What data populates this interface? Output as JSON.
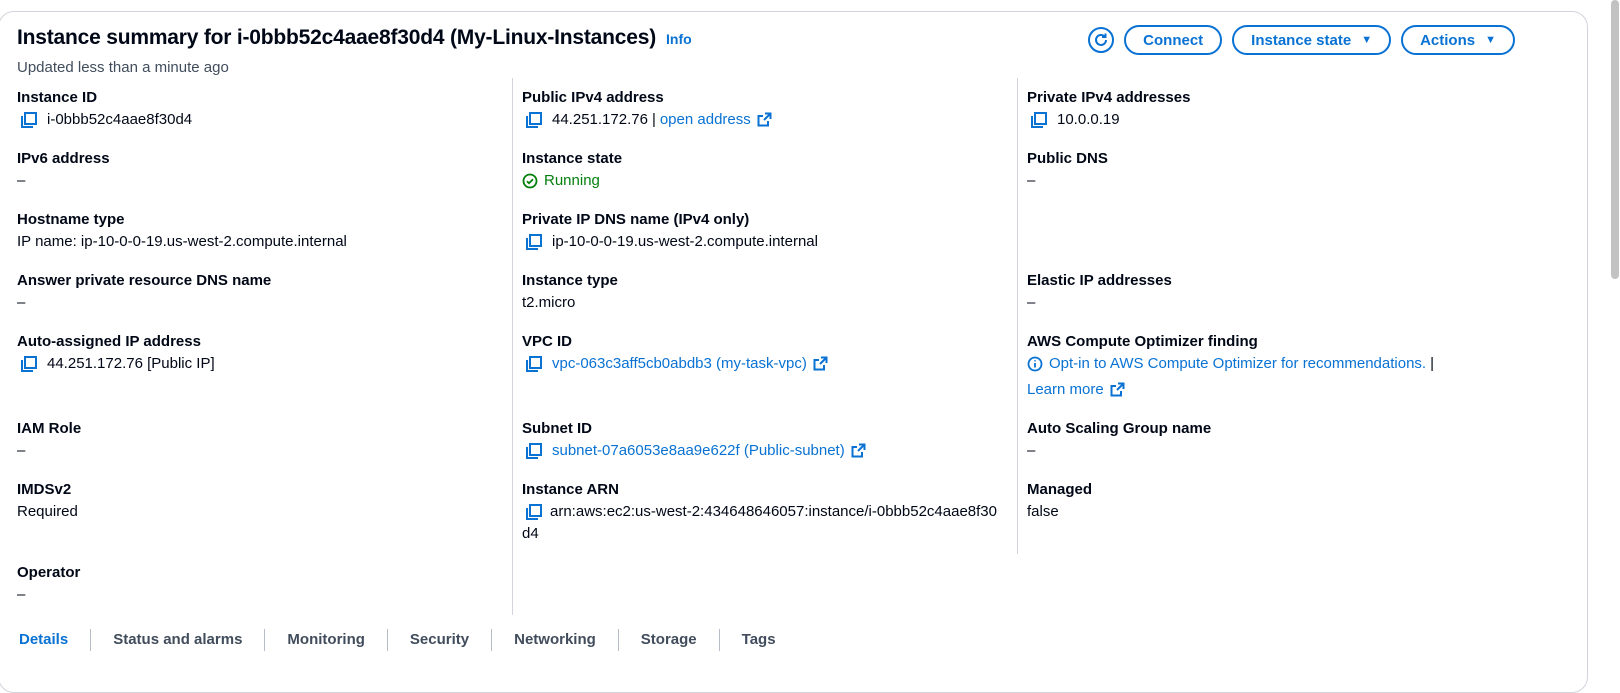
{
  "header": {
    "title": "Instance summary for i-0bbb52c4aae8f30d4 (My-Linux-Instances)",
    "info_link": "Info",
    "updated": "Updated less than a minute ago",
    "connect_label": "Connect",
    "instance_state_label": "Instance state",
    "actions_label": "Actions"
  },
  "fields": {
    "instance_id": {
      "label": "Instance ID",
      "value": "i-0bbb52c4aae8f30d4"
    },
    "public_ipv4": {
      "label": "Public IPv4 address",
      "value": "44.251.172.76",
      "separator": "|",
      "link": "open address"
    },
    "private_ipv4": {
      "label": "Private IPv4 addresses",
      "value": "10.0.0.19"
    },
    "ipv6": {
      "label": "IPv6 address",
      "value": "–"
    },
    "instance_state": {
      "label": "Instance state",
      "value": "Running"
    },
    "public_dns": {
      "label": "Public DNS",
      "value": "–"
    },
    "hostname_type": {
      "label": "Hostname type",
      "value": "IP name: ip-10-0-0-19.us-west-2.compute.internal"
    },
    "private_dns": {
      "label": "Private IP DNS name (IPv4 only)",
      "value": "ip-10-0-0-19.us-west-2.compute.internal"
    },
    "answer_dns": {
      "label": "Answer private resource DNS name",
      "value": "–"
    },
    "instance_type": {
      "label": "Instance type",
      "value": "t2.micro"
    },
    "elastic_ip": {
      "label": "Elastic IP addresses",
      "value": "–"
    },
    "auto_ip": {
      "label": "Auto-assigned IP address",
      "value": "44.251.172.76 [Public IP]"
    },
    "vpc_id": {
      "label": "VPC ID",
      "value": "vpc-063c3aff5cb0abdb3 (my-task-vpc)"
    },
    "optimizer": {
      "label": "AWS Compute Optimizer finding",
      "value": "Opt-in to AWS Compute Optimizer for recommendations.",
      "separator": "|",
      "learn_more": "Learn more"
    },
    "iam_role": {
      "label": "IAM Role",
      "value": "–"
    },
    "subnet_id": {
      "label": "Subnet ID",
      "value": "subnet-07a6053e8aa9e622f (Public-subnet)"
    },
    "asg_name": {
      "label": "Auto Scaling Group name",
      "value": "–"
    },
    "imdsv2": {
      "label": "IMDSv2",
      "value": "Required"
    },
    "arn": {
      "label": "Instance ARN",
      "value": "arn:aws:ec2:us-west-2:434648646057:instance/i-0bbb52c4aae8f30d4"
    },
    "managed": {
      "label": "Managed",
      "value": "false"
    },
    "operator": {
      "label": "Operator",
      "value": "–"
    }
  },
  "tabs": [
    "Details",
    "Status and alarms",
    "Monitoring",
    "Security",
    "Networking",
    "Storage",
    "Tags"
  ],
  "colors": {
    "link": "#0972d3",
    "success": "#037f0c",
    "divider": "#d1d5db"
  },
  "icons": [
    "refresh-icon",
    "copy-icon",
    "external-link-icon",
    "status-ok-icon",
    "info-circle-icon",
    "caret-down-icon"
  ]
}
